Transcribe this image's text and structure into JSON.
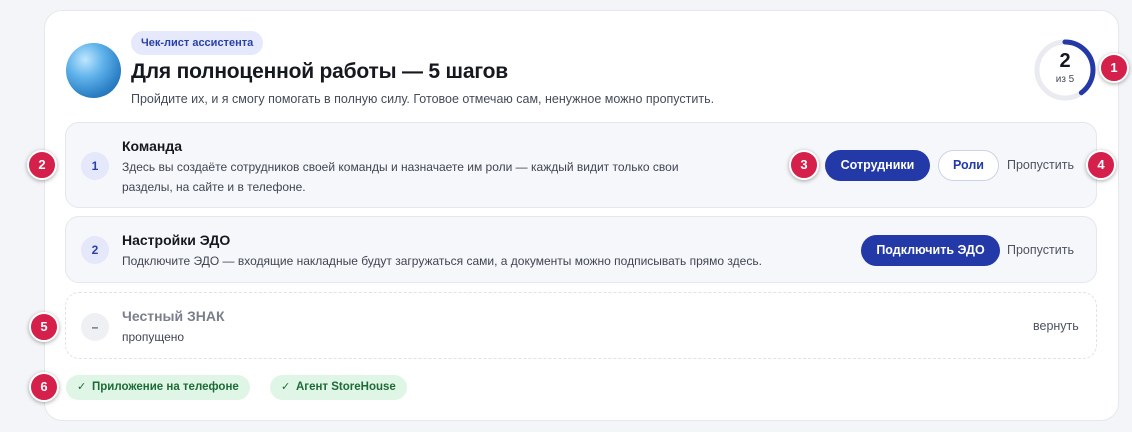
{
  "header": {
    "tag": "Чек-лист ассистента",
    "title": "Для полноценной работы — 5 шагов",
    "subtitle": "Пройдите их, и я смогу помогать в полную силу. Готовое отмечаю сам, ненужное можно пропустить."
  },
  "progress": {
    "done": "2",
    "of_label": "из 5",
    "fraction": 0.4,
    "color": "#2439a8"
  },
  "steps": [
    {
      "number": "1",
      "title": "Команда",
      "desc_line1": "Здесь вы создаёте сотрудников своей команды и назначаете им роли — каждый видит только свои",
      "desc_line2": "разделы, на сайте и в телефоне.",
      "primary": "Сотрудники",
      "secondary": "Роли",
      "skip": "Пропустить"
    },
    {
      "number": "2",
      "title": "Настройки ЭДО",
      "desc": "Подключите ЭДО — входящие накладные будут загружаться сами, а документы можно подписывать прямо здесь.",
      "primary": "Подключить ЭДО",
      "skip": "Пропустить"
    },
    {
      "number": "–",
      "title": "Честный ЗНАК",
      "desc": "пропущено",
      "return": "вернуть"
    }
  ],
  "completed": [
    {
      "label": "Приложение на телефоне",
      "icon": "check-icon"
    },
    {
      "label": "Агент StoreHouse",
      "icon": "check-icon"
    }
  ],
  "markers": [
    "1",
    "2",
    "3",
    "4",
    "5",
    "6"
  ],
  "colors": {
    "accent": "#2439a8",
    "marker": "#d4204a",
    "done_chip": "#dff5e6"
  }
}
